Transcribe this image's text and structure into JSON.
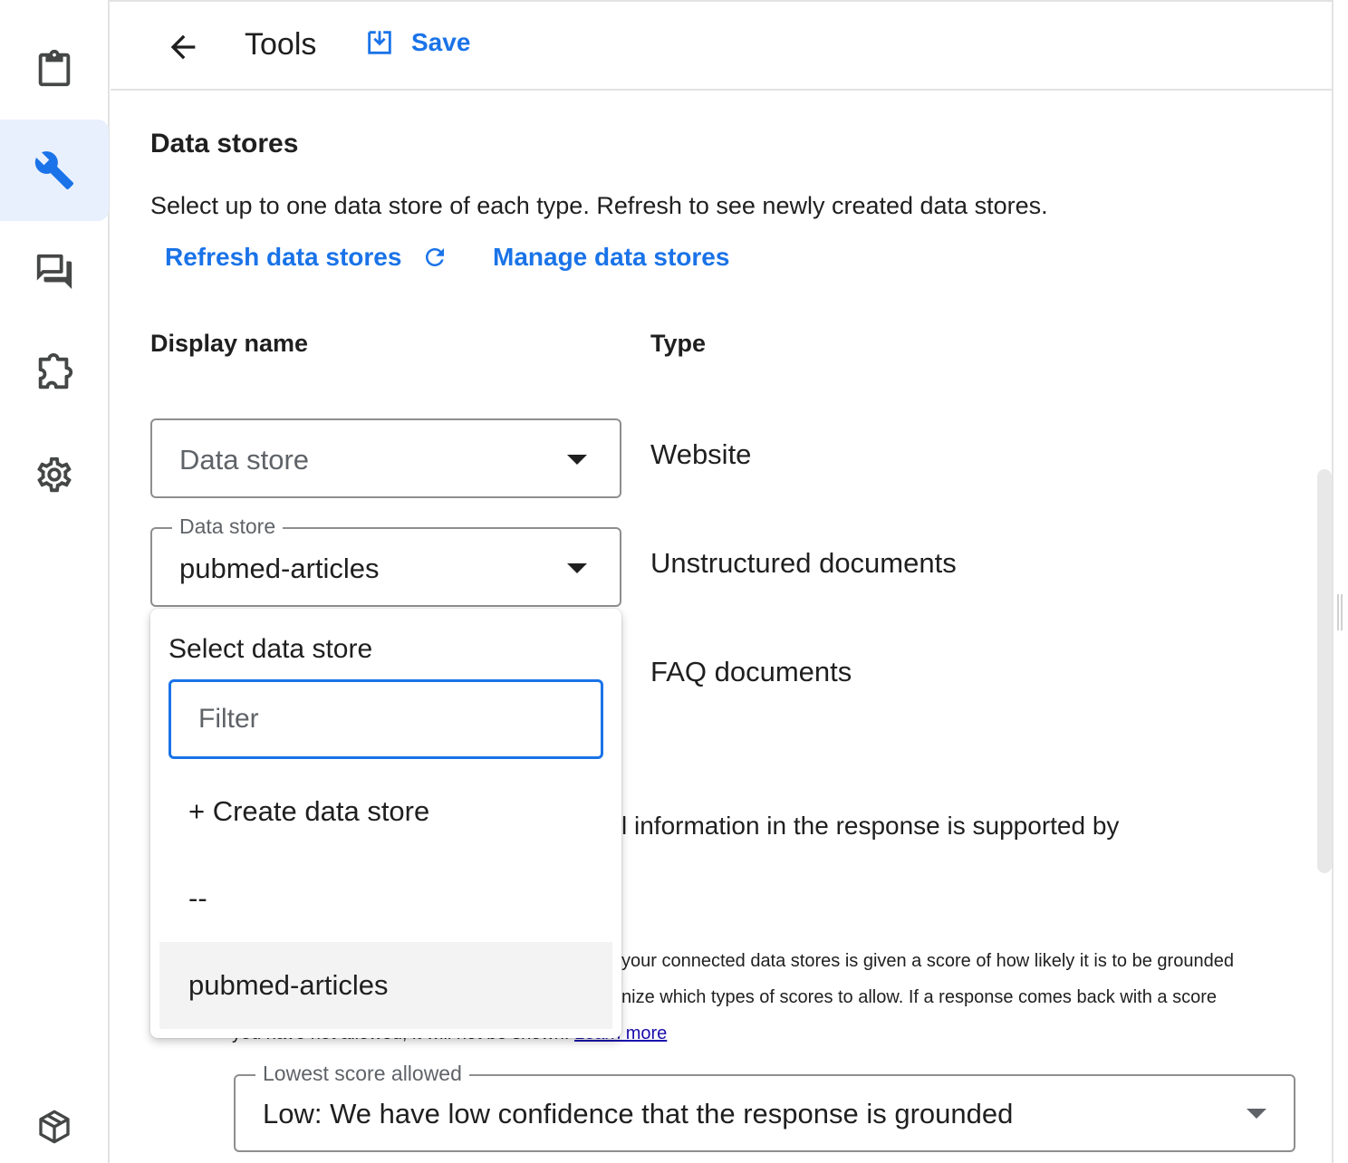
{
  "rail": {
    "items": [
      {
        "name": "clipboard",
        "icon": "clipboard-icon"
      },
      {
        "name": "tools",
        "icon": "wrench-icon",
        "active": true
      },
      {
        "name": "conversations",
        "icon": "forum-icon"
      },
      {
        "name": "extensions",
        "icon": "puzzle-icon"
      },
      {
        "name": "settings",
        "icon": "gear-icon"
      },
      {
        "name": "package",
        "icon": "package-icon"
      }
    ]
  },
  "header": {
    "title": "Tools",
    "save_label": "Save"
  },
  "data_stores": {
    "title": "Data stores",
    "description": "Select up to one data store of each type. Refresh to see newly created data stores.",
    "refresh_label": "Refresh data stores",
    "manage_label": "Manage data stores",
    "col_display_name": "Display name",
    "col_type": "Type",
    "rows": [
      {
        "placeholder": "Data store",
        "value": "",
        "type": "Website"
      },
      {
        "float_label": "Data store",
        "value": "pubmed-articles",
        "type": "Unstructured documents"
      },
      {
        "value": "",
        "type": "FAQ documents"
      }
    ]
  },
  "grounding": {
    "line1_visible": "l information in the response is supported by",
    "line2_visible": "your connected data stores is given a score of how likely it is to be grounded",
    "line3_visible": "nize which types of scores to allow. If a response comes back with a score",
    "line4_visible": "you have not allowed, it will not be shown.",
    "learn_more": "Learn more",
    "score_label": "Lowest score allowed",
    "score_value": "Low: We have low confidence that the response is grounded"
  },
  "dropdown": {
    "title": "Select data store",
    "filter_placeholder": "Filter",
    "options": [
      "+ Create data store",
      "--",
      "pubmed-articles"
    ],
    "selected_index": 2
  },
  "colors": {
    "accent": "#1a73e8",
    "active_rail_bg": "#e8f0fe",
    "text": "#1f1f1f",
    "muted": "#5f6368"
  }
}
